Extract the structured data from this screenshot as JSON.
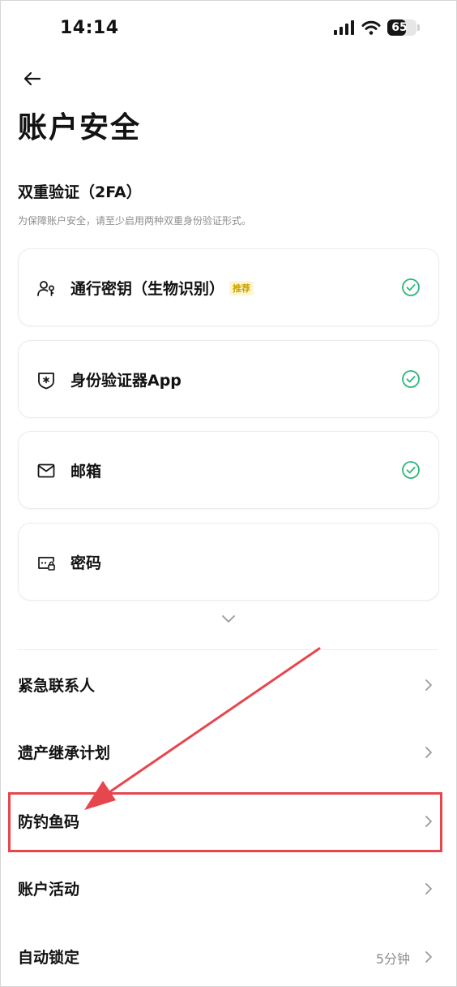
{
  "status_bar": {
    "time": "14:14",
    "battery_level": "65",
    "icons": [
      "cellular-signal-icon",
      "wifi-icon",
      "battery-icon"
    ]
  },
  "header": {
    "back_icon": "arrow-left-icon",
    "title": "账户安全"
  },
  "twofa": {
    "title": "双重验证（2FA）",
    "description": "为保障账户安全，请至少启用两种双重身份验证形式。",
    "methods": [
      {
        "icon": "passkey-person-icon",
        "label": "通行密钥（生物识别）",
        "badge": "推荐",
        "status": "enabled"
      },
      {
        "icon": "authenticator-shield-icon",
        "label": "身份验证器App",
        "status": "enabled"
      },
      {
        "icon": "email-icon",
        "label": "邮箱",
        "status": "enabled"
      },
      {
        "icon": "password-lock-icon",
        "label": "密码",
        "status": "not-enabled"
      }
    ],
    "expand_icon": "chevron-down-icon"
  },
  "settings": [
    {
      "label": "紧急联系人"
    },
    {
      "label": "遗产继承计划"
    },
    {
      "label": "防钓鱼码",
      "highlighted": true
    },
    {
      "label": "账户活动"
    },
    {
      "label": "自动锁定",
      "value": "5分钟"
    }
  ],
  "colors": {
    "check_green": "#2fb67c",
    "highlight_red": "#e6474f",
    "badge_yellow": "#caa300",
    "badge_bg": "#fff6cf"
  }
}
